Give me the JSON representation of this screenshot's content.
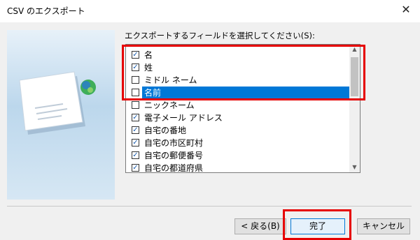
{
  "window": {
    "title": "CSV のエクスポート",
    "close_glyph": "✕"
  },
  "prompt": "エクスポートするフィールドを選択してください(S):",
  "fields": [
    {
      "label": "名",
      "checked": true,
      "selected": false
    },
    {
      "label": "姓",
      "checked": true,
      "selected": false
    },
    {
      "label": "ミドル ネーム",
      "checked": false,
      "selected": false
    },
    {
      "label": "名前",
      "checked": false,
      "selected": true
    },
    {
      "label": "ニックネーム",
      "checked": false,
      "selected": false
    },
    {
      "label": "電子メール アドレス",
      "checked": true,
      "selected": false
    },
    {
      "label": "自宅の番地",
      "checked": true,
      "selected": false
    },
    {
      "label": "自宅の市区町村",
      "checked": true,
      "selected": false
    },
    {
      "label": "自宅の郵便番号",
      "checked": true,
      "selected": false
    },
    {
      "label": "自宅の都道府県",
      "checked": true,
      "selected": false
    }
  ],
  "buttons": {
    "back": "< 戻る(B)",
    "finish": "完了",
    "cancel": "キャンセル"
  },
  "colors": {
    "selection": "#0078d7",
    "annotation_red": "#e60000"
  },
  "icons": {
    "wizard_art": "envelope-globe-icon",
    "checkbox_mark": "check-icon"
  }
}
